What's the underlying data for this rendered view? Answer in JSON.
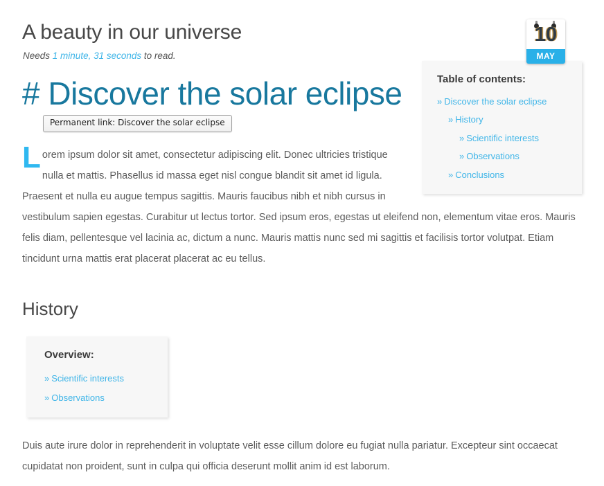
{
  "article": {
    "title": "A beauty in our universe",
    "reading_time_prefix": "Needs",
    "reading_time_value": "1 minute, 31 seconds",
    "reading_time_suffix": "to read."
  },
  "date_badge": {
    "day": "10",
    "month": "MAY",
    "icon": "calendar-icon"
  },
  "section": {
    "anchor_symbol": "#",
    "heading": "Discover the solar eclipse",
    "permalink_tooltip": "Permanent link: Discover the solar eclipse"
  },
  "toc": {
    "title": "Table of contents:",
    "bullet": "»",
    "items": [
      {
        "label": "Discover the solar eclipse",
        "level": 1
      },
      {
        "label": "History",
        "level": 2
      },
      {
        "label": "Scientific interests",
        "level": 3
      },
      {
        "label": "Observations",
        "level": 3
      },
      {
        "label": "Conclusions",
        "level": 2
      }
    ]
  },
  "lead": {
    "dropcap": "L",
    "text": "orem ipsum dolor sit amet, consectetur adipiscing elit. Donec ultricies tristique nulla et mattis. Phasellus id massa eget nisl congue blandit sit amet id ligula. Praesent et nulla eu augue tempus sagittis. Mauris faucibus nibh et nibh cursus in vestibulum sapien egestas. Curabitur ut lectus tortor. Sed ipsum eros, egestas ut eleifend non, elementum vitae eros. Mauris felis diam, pellentesque vel lacinia ac, dictum a nunc. Mauris mattis nunc sed mi sagittis et facilisis tortor volutpat. Etiam tincidunt urna mattis erat placerat placerat ac eu tellus."
  },
  "history": {
    "heading": "History",
    "overview": {
      "title": "Overview:",
      "bullet": "»",
      "items": [
        {
          "label": "Scientific interests"
        },
        {
          "label": "Observations"
        }
      ]
    },
    "paragraph": "Duis aute irure dolor in reprehenderit in voluptate velit esse cillum dolore eu fugiat nulla pariatur. Excepteur sint occaecat cupidatat non proident, sunt in culpa qui officia deserunt mollit anim id est laborum."
  },
  "colors": {
    "heading_teal": "#18789e",
    "link_blue": "#3fb5e8",
    "badge_blue": "#29b0e8",
    "body_text": "#5b5b5b",
    "box_background": "#f7f7f7"
  }
}
